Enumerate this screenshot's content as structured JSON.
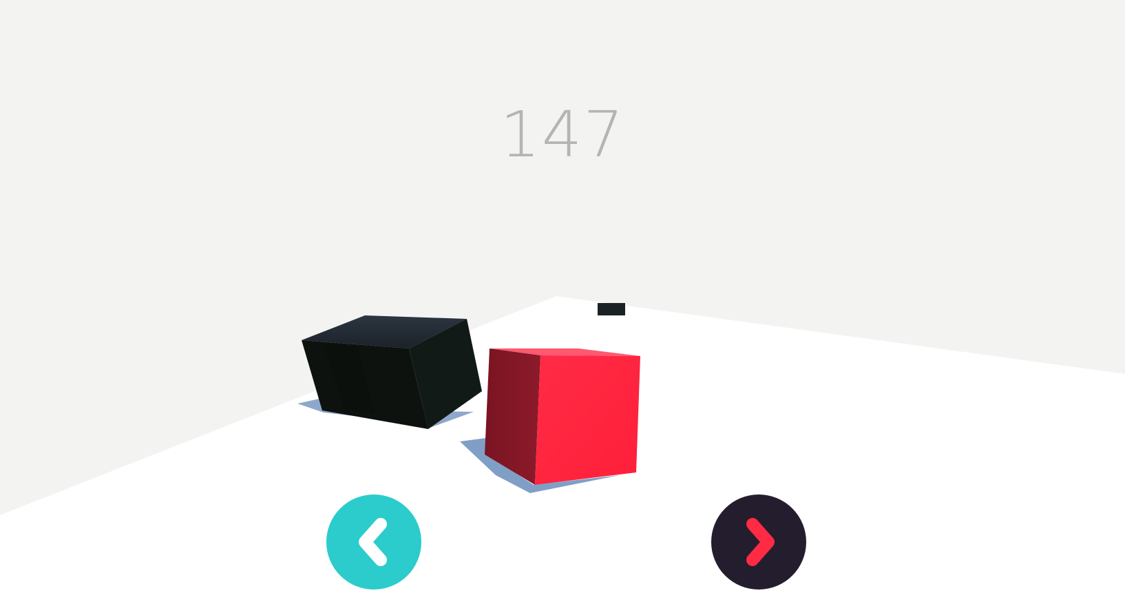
{
  "game": {
    "score": "147"
  },
  "controls": {
    "left": {
      "icon": "chevron-left-icon",
      "background_color": "#2bcccb",
      "icon_color": "#ffffff"
    },
    "right": {
      "icon": "chevron-right-icon",
      "background_color": "#241d2d",
      "icon_color": "#ff2a44"
    }
  },
  "colors": {
    "background": "#f3f4f2",
    "floor": "#ffffff",
    "player_cube": "#ff2540",
    "obstacle_block": "#0f1512",
    "shadow": "#7f9fc6",
    "score_text": "#b3b5b1"
  }
}
